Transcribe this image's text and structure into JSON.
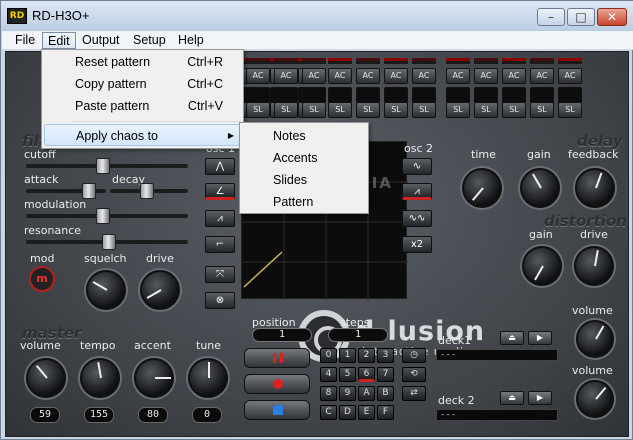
{
  "window": {
    "title": "RD-H3O+",
    "app_icon": "RD",
    "minimize": "–",
    "maximize": "□",
    "close": "✕"
  },
  "menubar": {
    "file": "File",
    "edit": "Edit",
    "output": "Output",
    "setup": "Setup",
    "help": "Help"
  },
  "edit_menu": {
    "reset": {
      "label": "Reset pattern",
      "shortcut": "Ctrl+R"
    },
    "copy": {
      "label": "Copy pattern",
      "shortcut": "Ctrl+C"
    },
    "paste": {
      "label": "Paste pattern",
      "shortcut": "Ctrl+V"
    },
    "chaos": {
      "label": "Apply chaos to",
      "arrow": "▶"
    }
  },
  "chaos_submenu": {
    "notes": "Notes",
    "accents": "Accents",
    "slides": "Slides",
    "pattern": "Pattern"
  },
  "step_buttons": {
    "ac": "AC",
    "sl": "SL"
  },
  "filter": {
    "section": "filter",
    "cutoff": "cutoff",
    "attack": "attack",
    "decay": "decay",
    "modulation": "modulation",
    "resonance": "resonance",
    "mod": "mod",
    "mod_button": "m",
    "squelch": "squelch",
    "drive": "drive"
  },
  "osc1": {
    "label": "osc 1"
  },
  "osc2": {
    "label": "osc 2",
    "x2": "x2"
  },
  "delay": {
    "section": "delay",
    "time": "time",
    "gain": "gain",
    "feedback": "feedback"
  },
  "distortion": {
    "section": "distortion",
    "gain": "gain",
    "drive": "drive"
  },
  "master": {
    "section": "master",
    "volume": "volume",
    "tempo": "tempo",
    "accent": "accent",
    "tune": "tune",
    "volume_val": "59",
    "tempo_val": "155",
    "accent_val": "80",
    "tune_val": "0"
  },
  "logo": {
    "name": "d-lusion",
    "tagline": "interactive media"
  },
  "position": {
    "label": "position",
    "value": "1"
  },
  "steps": {
    "label": "steps",
    "value": "1"
  },
  "keypad": [
    "0",
    "1",
    "2",
    "3",
    "4",
    "5",
    "6",
    "7",
    "8",
    "9",
    "A",
    "B",
    "C",
    "D",
    "E",
    "F"
  ],
  "deck1": {
    "label": "deck1",
    "display": "---",
    "volume": "volume"
  },
  "deck2": {
    "label": "deck 2",
    "display": "---",
    "volume": "volume"
  },
  "watermark": "SOFTPEDIA"
}
